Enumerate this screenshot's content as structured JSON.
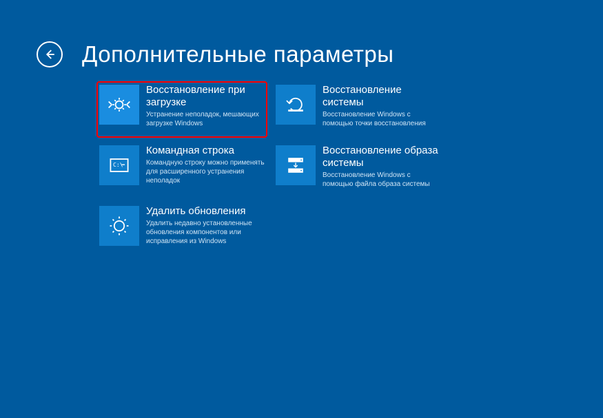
{
  "header": {
    "title": "Дополнительные параметры"
  },
  "tiles": [
    {
      "title": "Восстановление при загрузке",
      "desc": "Устранение неполадок, мешающих загрузке Windows",
      "icon": "startup-repair-icon",
      "highlighted": true
    },
    {
      "title": "Восстановление системы",
      "desc": "Восстановление Windows с помощью точки восстановления",
      "icon": "system-restore-icon",
      "highlighted": false
    },
    {
      "title": "Командная строка",
      "desc": "Командную строку можно применять для расширенного устранения неполадок",
      "icon": "command-prompt-icon",
      "highlighted": false
    },
    {
      "title": "Восстановление образа системы",
      "desc": "Восстановление Windows с помощью файла образа системы",
      "icon": "system-image-icon",
      "highlighted": false
    },
    {
      "title": "Удалить обновления",
      "desc": "Удалить недавно установленные обновления компонентов или исправления из Windows",
      "icon": "uninstall-updates-icon",
      "highlighted": false
    }
  ],
  "colors": {
    "background": "#005a9e",
    "tile_background": "#0f7ecb",
    "tile_highlighted_bg": "#1a8de0",
    "highlight_border": "#ff0000"
  }
}
